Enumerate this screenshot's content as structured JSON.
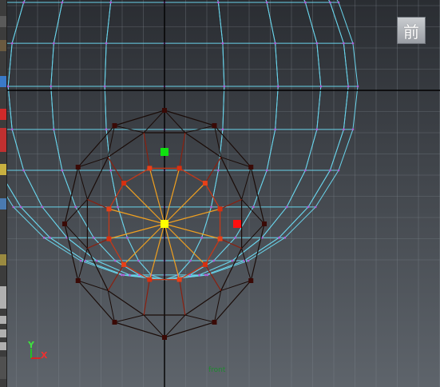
{
  "view_cube": {
    "label": "前"
  },
  "camera": {
    "name": "front"
  },
  "axis": {
    "y": "Y",
    "x": "X"
  },
  "colors": {
    "background_top": "#2a2d32",
    "background_bottom": "#5e646b",
    "grid": "#7f868e",
    "axis_line": "#000000",
    "wireframe": "#69d3ea",
    "selected_edge": "#1a0c08",
    "soft_select_outer": "#c43818",
    "soft_select_inner": "#f0a020",
    "selected_vertex": "#ffff00",
    "manipulator_x": "#ff1010",
    "manipulator_y": "#10e010"
  }
}
